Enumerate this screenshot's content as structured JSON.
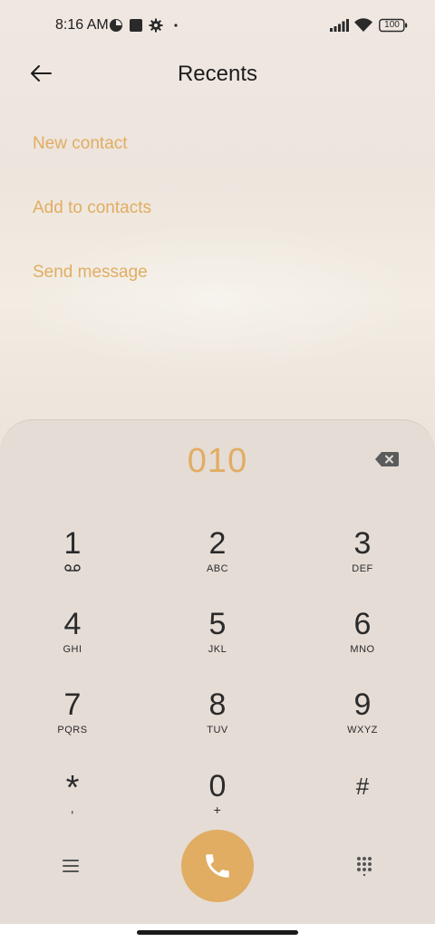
{
  "status_bar": {
    "time": "8:16 AM",
    "battery": "100",
    "icons": [
      "pie-chart-icon",
      "square-app-icon",
      "gear-icon",
      "dot-icon",
      "signal-icon",
      "wifi-icon",
      "battery-icon"
    ]
  },
  "app_bar": {
    "title": "Recents",
    "back_icon": "arrow-left-icon"
  },
  "actions": [
    {
      "label": "New contact"
    },
    {
      "label": "Add to contacts"
    },
    {
      "label": "Send message"
    }
  ],
  "dialer": {
    "number": "010",
    "keys": [
      {
        "digit": "1",
        "letters": ""
      },
      {
        "digit": "2",
        "letters": "ABC"
      },
      {
        "digit": "3",
        "letters": "DEF"
      },
      {
        "digit": "4",
        "letters": "GHI"
      },
      {
        "digit": "5",
        "letters": "JKL"
      },
      {
        "digit": "6",
        "letters": "MNO"
      },
      {
        "digit": "7",
        "letters": "PQRS"
      },
      {
        "digit": "8",
        "letters": "TUV"
      },
      {
        "digit": "9",
        "letters": "WXYZ"
      },
      {
        "digit": "*",
        "letters": ","
      },
      {
        "digit": "0",
        "letters": "+"
      },
      {
        "digit": "#",
        "letters": ""
      }
    ],
    "bottom_icons": [
      "menu-icon",
      "phone-icon",
      "keypad-icon"
    ]
  },
  "colors": {
    "accent": "#e1ad62",
    "dialpad_bg": "#e5dcd6",
    "text": "#2a2a2a"
  }
}
